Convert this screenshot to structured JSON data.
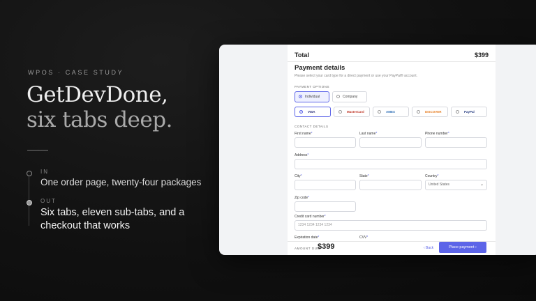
{
  "hero": {
    "eyebrow": "WPOS · CASE STUDY",
    "title_line1": "GetDevDone,",
    "title_line2": "six tabs deep."
  },
  "timeline": {
    "in_label": "IN",
    "in_text": "One order page, twenty-four packages",
    "out_label": "OUT",
    "out_text": "Six tabs, eleven sub-tabs, and a checkout that works"
  },
  "checkout": {
    "total_label": "Total",
    "total_value": "$399",
    "payment_title": "Payment details",
    "payment_subtitle": "Please select your card type for a direct payment or use your PayPal® account.",
    "payment_options_label": "PAYMENT OPTIONS",
    "options": [
      "Individual",
      "Company"
    ],
    "cards": [
      "VISA",
      "MasterCard",
      "AMEX",
      "DISCOVER",
      "PayPal"
    ],
    "contact_label": "CONTACT DETAILS",
    "fields": {
      "first_name": "First name",
      "last_name": "Last name",
      "phone": "Phone number",
      "address": "Address",
      "city": "City",
      "state": "State",
      "country": "Country",
      "country_value": "United States",
      "zip": "Zip code",
      "card_number": "Credit card number",
      "card_number_placeholder": "1234 1234 1234 1234",
      "expiration": "Expiration date",
      "cvv": "CVV"
    },
    "amount_due_label": "AMOUNT DUE",
    "amount_due_value": "$399",
    "back_label": "‹ Back",
    "place_payment_label": "Place payment ›",
    "colors": {
      "accent": "#5c64e8"
    }
  }
}
